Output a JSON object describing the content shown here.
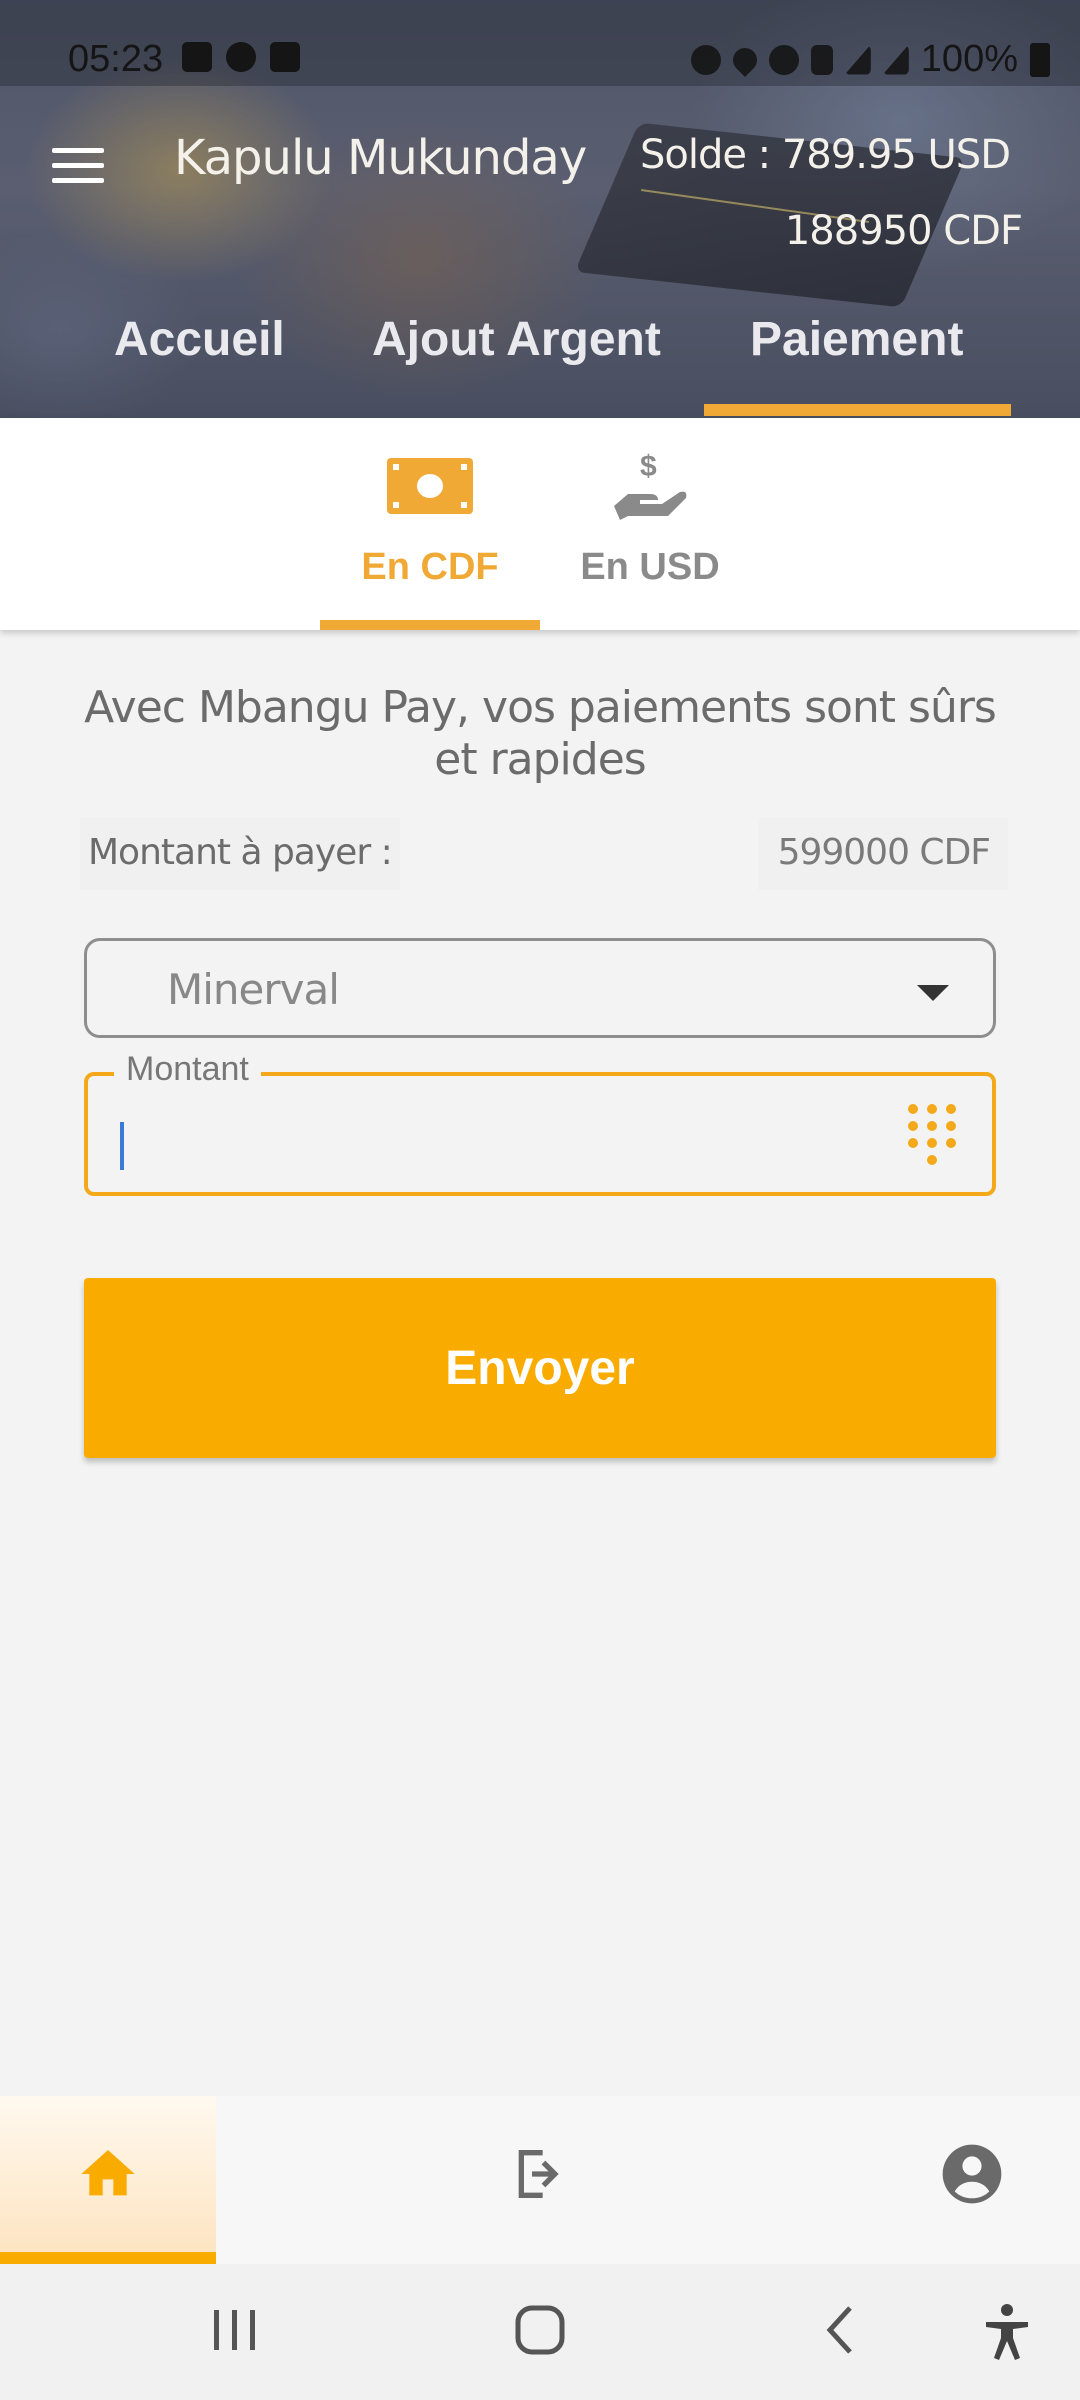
{
  "status_bar": {
    "time": "05:23",
    "battery": "100%"
  },
  "header": {
    "user_name": "Kapulu Mukunday",
    "balance_usd": "Solde : 789.95 USD",
    "balance_cdf": "188950 CDF",
    "menu_icon": "hamburger-menu-icon"
  },
  "tabs": [
    {
      "label": "Accueil",
      "active": false
    },
    {
      "label": "Ajout Argent",
      "active": false
    },
    {
      "label": "Paiement",
      "active": true
    }
  ],
  "sub_tabs": [
    {
      "label": "En CDF",
      "icon": "banknote-icon",
      "active": true
    },
    {
      "label": "En USD",
      "icon": "hand-dollar-icon",
      "active": false
    }
  ],
  "content": {
    "tagline": "Avec Mbangu Pay, vos paiements sont sûrs et rapides",
    "amount_label": "Montant à payer :",
    "amount_value": "599000 CDF",
    "select_value": "Minerval",
    "input_label": "Montant",
    "input_value": "",
    "send_label": "Envoyer"
  },
  "bottom_nav": [
    {
      "icon": "home-icon",
      "active": true
    },
    {
      "icon": "logout-icon",
      "active": false
    },
    {
      "icon": "account-icon",
      "active": false
    }
  ],
  "colors": {
    "accent": "#f9ab00",
    "tab_indicator": "#f0a935",
    "background": "#f3f3f3"
  }
}
